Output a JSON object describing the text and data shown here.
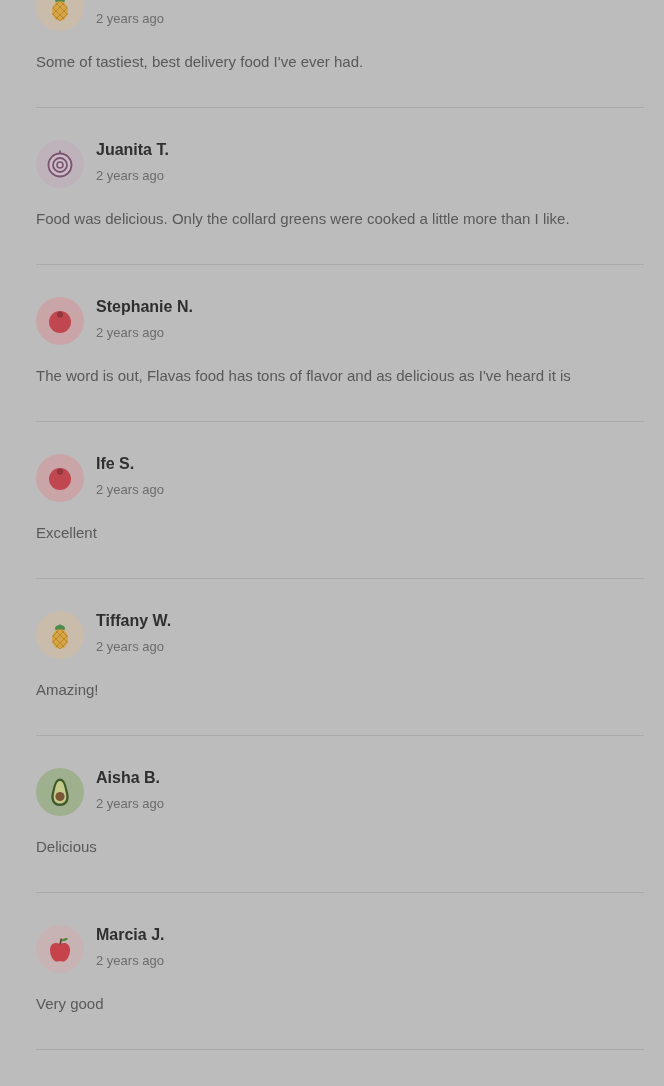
{
  "reviews": [
    {
      "avatar": {
        "kind": "pineapple"
      },
      "time": "2 years ago",
      "text": "Some of tastiest, best delivery food I've ever had."
    },
    {
      "name": "Juanita T.",
      "avatar": {
        "kind": "onion"
      },
      "time": "2 years ago",
      "text": "Food was delicious. Only the collard greens were cooked a little more than I like."
    },
    {
      "name": "Stephanie N.",
      "avatar": {
        "kind": "tomato"
      },
      "time": "2 years ago",
      "text": "The word is out, Flavas food has tons of flavor and as delicious as I've heard it is"
    },
    {
      "name": "Ife S.",
      "avatar": {
        "kind": "tomato"
      },
      "time": "2 years ago",
      "text": "Excellent"
    },
    {
      "name": "Tiffany W.",
      "avatar": {
        "kind": "pineapple"
      },
      "time": "2 years ago",
      "text": "Amazing!"
    },
    {
      "name": "Aisha B.",
      "avatar": {
        "kind": "avocado"
      },
      "time": "2 years ago",
      "text": "Delicious"
    },
    {
      "name": "Marcia J.",
      "avatar": {
        "kind": "apple"
      },
      "time": "2 years ago",
      "text": "Very good"
    }
  ]
}
